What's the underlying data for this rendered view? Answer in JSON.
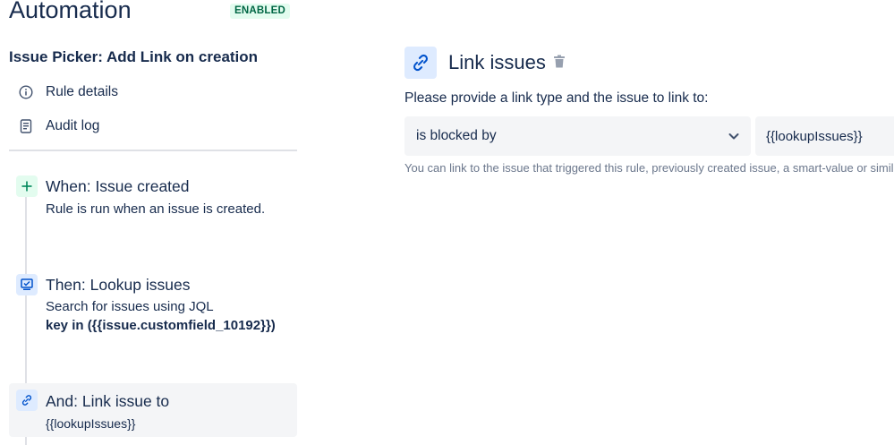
{
  "header": {
    "title": "Automation",
    "status": "ENABLED"
  },
  "rule": {
    "name": "Issue Picker: Add Link on creation"
  },
  "nav": {
    "rule_details": {
      "label": "Rule details",
      "icon": "info-icon"
    },
    "audit_log": {
      "label": "Audit log",
      "icon": "document-icon"
    }
  },
  "steps": [
    {
      "title": "When: Issue created",
      "description": "Rule is run when an issue is created.",
      "icon": "plus-icon"
    },
    {
      "title": "Then: Lookup issues",
      "description": "Search for issues using JQL",
      "jql": "key in ({{issue.customfield_10192}})",
      "icon": "lookup-icon"
    },
    {
      "title": "And: Link issue to",
      "description": "{{lookupIssues}}",
      "icon": "link-icon"
    }
  ],
  "panel": {
    "title": "Link issues",
    "icon": "link-icon",
    "prompt": "Please provide a link type and the issue to link to:",
    "link_type": "is blocked by",
    "issue_value": "{{lookupIssues}}",
    "help": "You can link to the issue that triggered this rule, previously created issue, a smart-value or similar."
  },
  "colors": {
    "text": "#172b4d",
    "badge_bg": "#e3fcef",
    "badge_text": "#006644",
    "accent": "#0052cc",
    "field_bg": "#f4f5f7"
  }
}
